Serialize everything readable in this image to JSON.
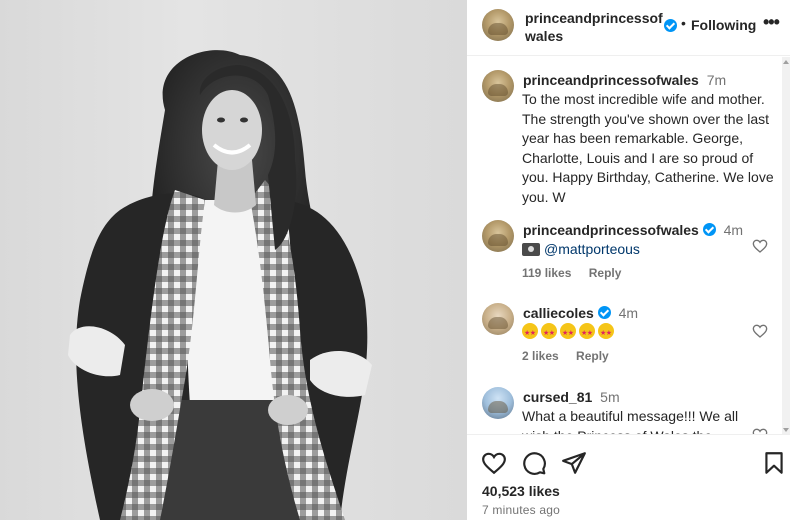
{
  "post": {
    "account": "princeandprincessofwales",
    "header_name_line1": "princeandprincessof",
    "header_name_line2": "wales",
    "follow_status": "Following",
    "more_label": "•••",
    "dot": "•"
  },
  "comments": [
    {
      "user": "princeandprincessofwales",
      "time": "7m",
      "text": "To the most incredible wife and mother. The strength you've shown over the last year has been remarkable. George, Charlotte, Louis and I are so proud of you. Happy Birthday, Catherine. We love you. W",
      "verified": true
    },
    {
      "user": "princeandprincessofwales",
      "time": "4m",
      "text": "@mattporteous",
      "icon": "camera-emoji",
      "likes": "119 likes",
      "reply": "Reply",
      "verified": true
    },
    {
      "user": "calliecoles",
      "time": "4m",
      "icon": "star-struck-emoji",
      "emoji_count": 5,
      "likes": "2 likes",
      "reply": "Reply",
      "verified": true
    },
    {
      "user": "cursed_81",
      "time": "5m",
      "text_line1": "What a beautiful message!!! We all",
      "text_line2": "wish the Princess of Wales the",
      "verified": false
    }
  ],
  "footer": {
    "likes": "40,523 likes",
    "time_ago": "7 minutes ago"
  },
  "colors": {
    "verified": "#0095f6",
    "text": "#262626",
    "secondary": "#737373",
    "mention": "#00376b"
  }
}
